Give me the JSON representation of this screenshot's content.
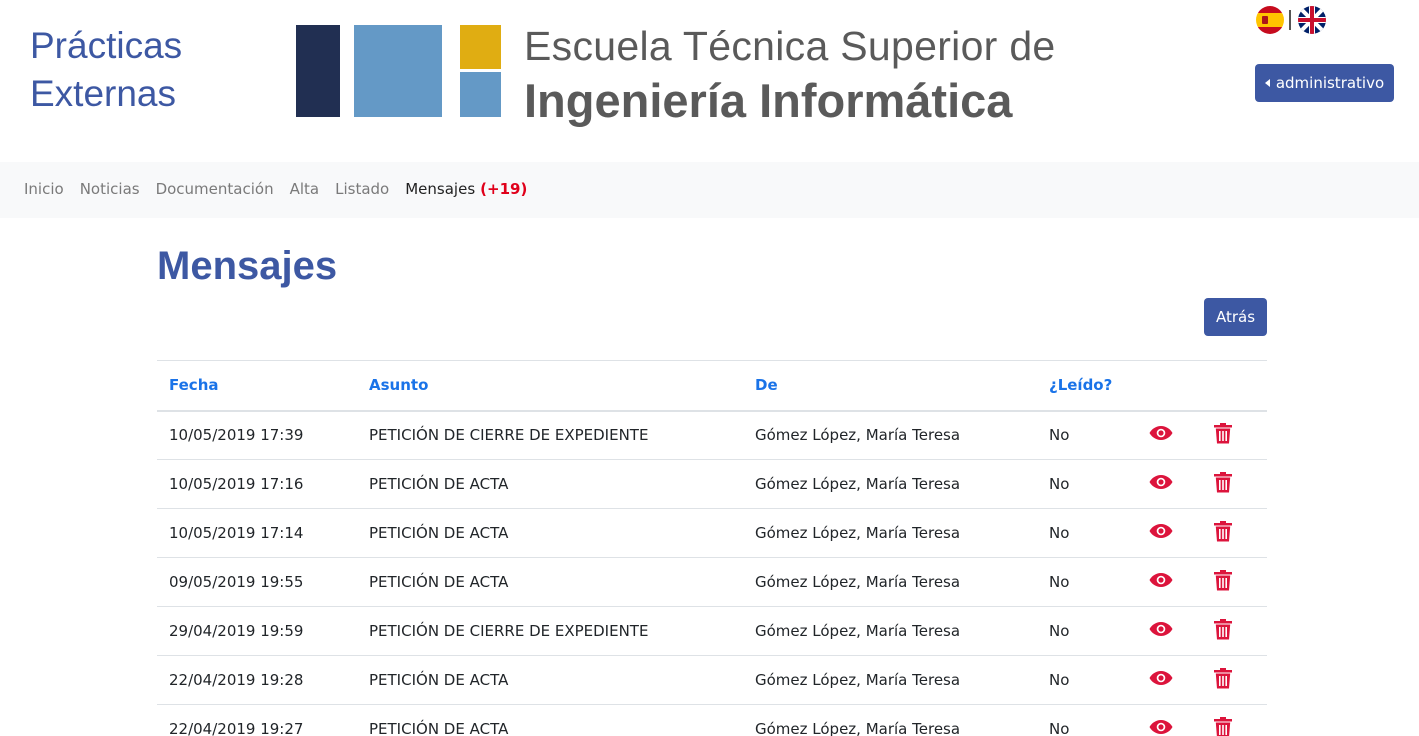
{
  "header": {
    "site_title_line1": "Prácticas",
    "site_title_line2": "Externas",
    "logo_line1": "Escuela Técnica Superior de",
    "logo_line2": "Ingeniería Informática",
    "user_button": "administrativo",
    "brand_colors": {
      "primary": "#3d58a3",
      "logo_dark": "#212f52",
      "logo_blue": "#6499c6",
      "logo_yellow": "#e0ad12"
    }
  },
  "nav": {
    "items": [
      {
        "label": "Inicio"
      },
      {
        "label": "Noticias"
      },
      {
        "label": "Documentación"
      },
      {
        "label": "Alta"
      },
      {
        "label": "Listado"
      },
      {
        "label": "Mensajes",
        "count": "(+19)",
        "active": true
      }
    ]
  },
  "main": {
    "title": "Mensajes",
    "back_button": "Atrás",
    "table": {
      "headers": [
        "Fecha",
        "Asunto",
        "De",
        "¿Leído?"
      ],
      "rows": [
        {
          "fecha": "10/05/2019 17:39",
          "asunto": "PETICIÓN DE CIERRE DE EXPEDIENTE",
          "de": "Gómez López, María Teresa",
          "leido": "No"
        },
        {
          "fecha": "10/05/2019 17:16",
          "asunto": "PETICIÓN DE ACTA",
          "de": "Gómez López, María Teresa",
          "leido": "No"
        },
        {
          "fecha": "10/05/2019 17:14",
          "asunto": "PETICIÓN DE ACTA",
          "de": "Gómez López, María Teresa",
          "leido": "No"
        },
        {
          "fecha": "09/05/2019 19:55",
          "asunto": "PETICIÓN DE ACTA",
          "de": "Gómez López, María Teresa",
          "leido": "No"
        },
        {
          "fecha": "29/04/2019 19:59",
          "asunto": "PETICIÓN DE CIERRE DE EXPEDIENTE",
          "de": "Gómez López, María Teresa",
          "leido": "No"
        },
        {
          "fecha": "22/04/2019 19:28",
          "asunto": "PETICIÓN DE ACTA",
          "de": "Gómez López, María Teresa",
          "leido": "No"
        },
        {
          "fecha": "22/04/2019 19:27",
          "asunto": "PETICIÓN DE ACTA",
          "de": "Gómez López, María Teresa",
          "leido": "No"
        }
      ],
      "row_icons": [
        "eye-icon",
        "trash-icon"
      ],
      "icon_color": "#dc143c"
    }
  }
}
